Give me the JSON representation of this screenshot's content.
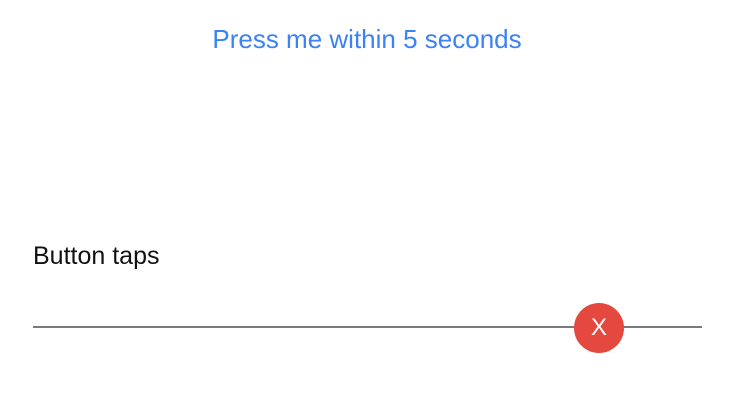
{
  "colors": {
    "accent": "#3a82f6",
    "danger": "#e5483e",
    "track": "#7a7a7a",
    "text": "#111111"
  },
  "press_button": {
    "label": "Press me within 5 seconds"
  },
  "button_taps": {
    "label": "Button taps",
    "thumb_label": "X",
    "progress_fraction": 0.84
  }
}
